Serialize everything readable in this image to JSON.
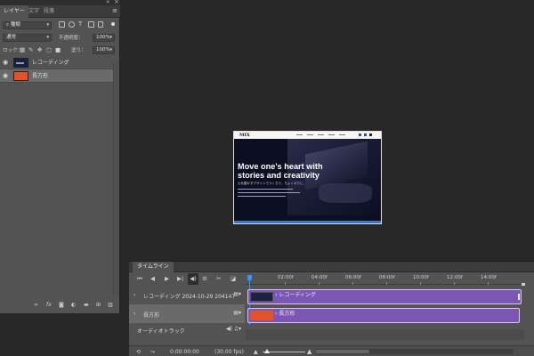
{
  "layers_panel": {
    "window_controls": {
      "collapse": "«",
      "close": "×"
    },
    "tabs": [
      "レイヤー",
      "文字",
      "段落"
    ],
    "menu_icon": "≡",
    "filter": {
      "kind_label": "種類"
    },
    "blend_mode": "通常",
    "opacity": {
      "label": "不透明度：",
      "value": "100%"
    },
    "lock": {
      "label": "ロック："
    },
    "fill": {
      "label": "塗り：",
      "value": "100%"
    },
    "layers": [
      {
        "name": "レコーディング",
        "thumb": "dark",
        "visible": true,
        "selected": false
      },
      {
        "name": "長方形",
        "thumb": "orange",
        "visible": true,
        "selected": true
      }
    ],
    "eye_glyph": "◉",
    "bottom_icons": [
      "link-icon",
      "fx-icon",
      "mask-icon",
      "adjustment-icon",
      "folder-icon",
      "new-layer-icon",
      "trash-icon"
    ]
  },
  "document": {
    "logo": "MIX",
    "headline_line1": "Move one's heart with",
    "headline_line2": "stories and creativity",
    "subline": "心を動かすデザインでつくろう、ちょくのりに。"
  },
  "timeline": {
    "tab_label": "タイムライン",
    "ruler_ticks": [
      "02:00f",
      "04:00f",
      "06:00f",
      "08:00f",
      "10:00f",
      "12:00f",
      "14:00f"
    ],
    "tracks": [
      {
        "name": "レコーディング 2024-10-29 204147",
        "clip_label": "レコーディング",
        "clip_thumb": "dark"
      },
      {
        "name": "長方形",
        "clip_label": "長方形",
        "clip_thumb": "orange"
      }
    ],
    "audio_track": "オーディオトラック",
    "timecode": "0:00:00:00",
    "fps": "(30.00 fps)"
  }
}
